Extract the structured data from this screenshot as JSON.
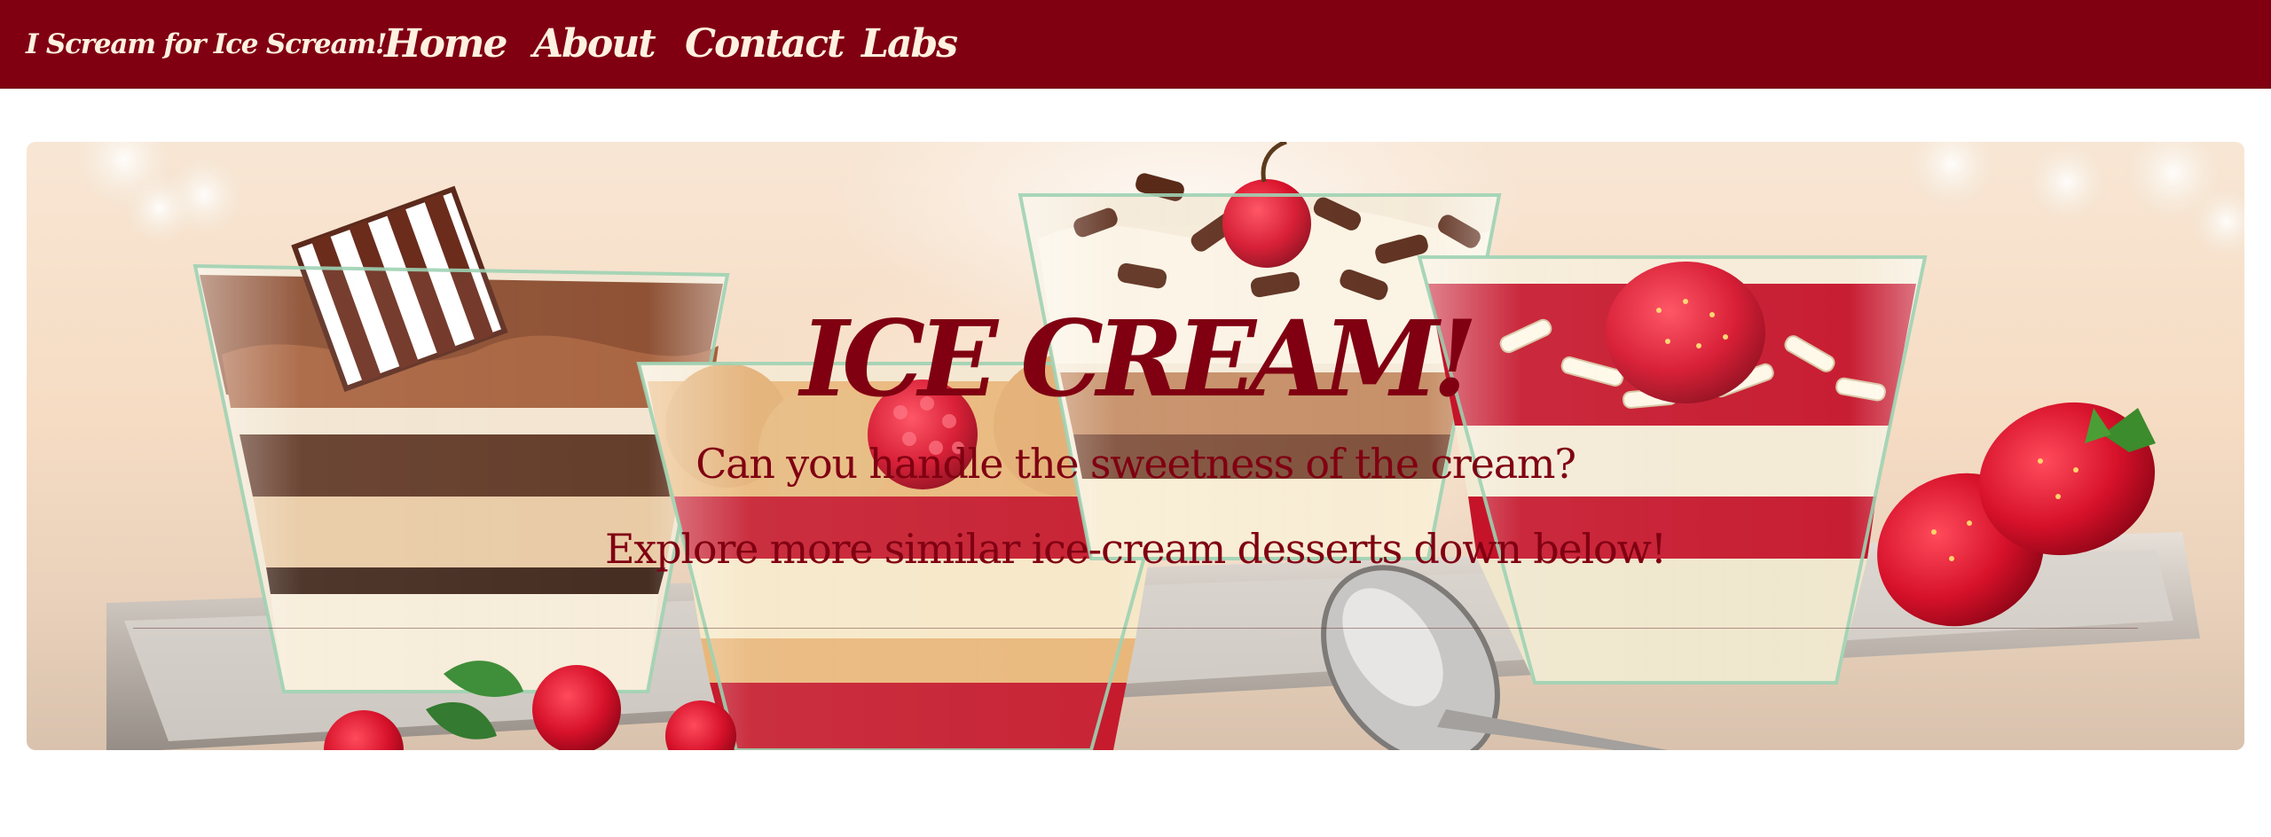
{
  "navbar": {
    "brand": "I Scream for Ice Scream!",
    "links": [
      {
        "label": "Home"
      },
      {
        "label": "About"
      },
      {
        "label": "Contact"
      },
      {
        "label": "Labs",
        "has_dropdown": true
      }
    ],
    "colors": {
      "background": "#800012",
      "text": "#fff1e0"
    }
  },
  "hero": {
    "title": "ICE CREAM!",
    "subtitle": "Can you handle the sweetness of the cream?",
    "tagline": "Explore more similar ice-cream desserts down below!",
    "text_color": "#800012",
    "image_subject": "ice cream parfait desserts with strawberries, cherry and chocolate on a silver tray"
  }
}
